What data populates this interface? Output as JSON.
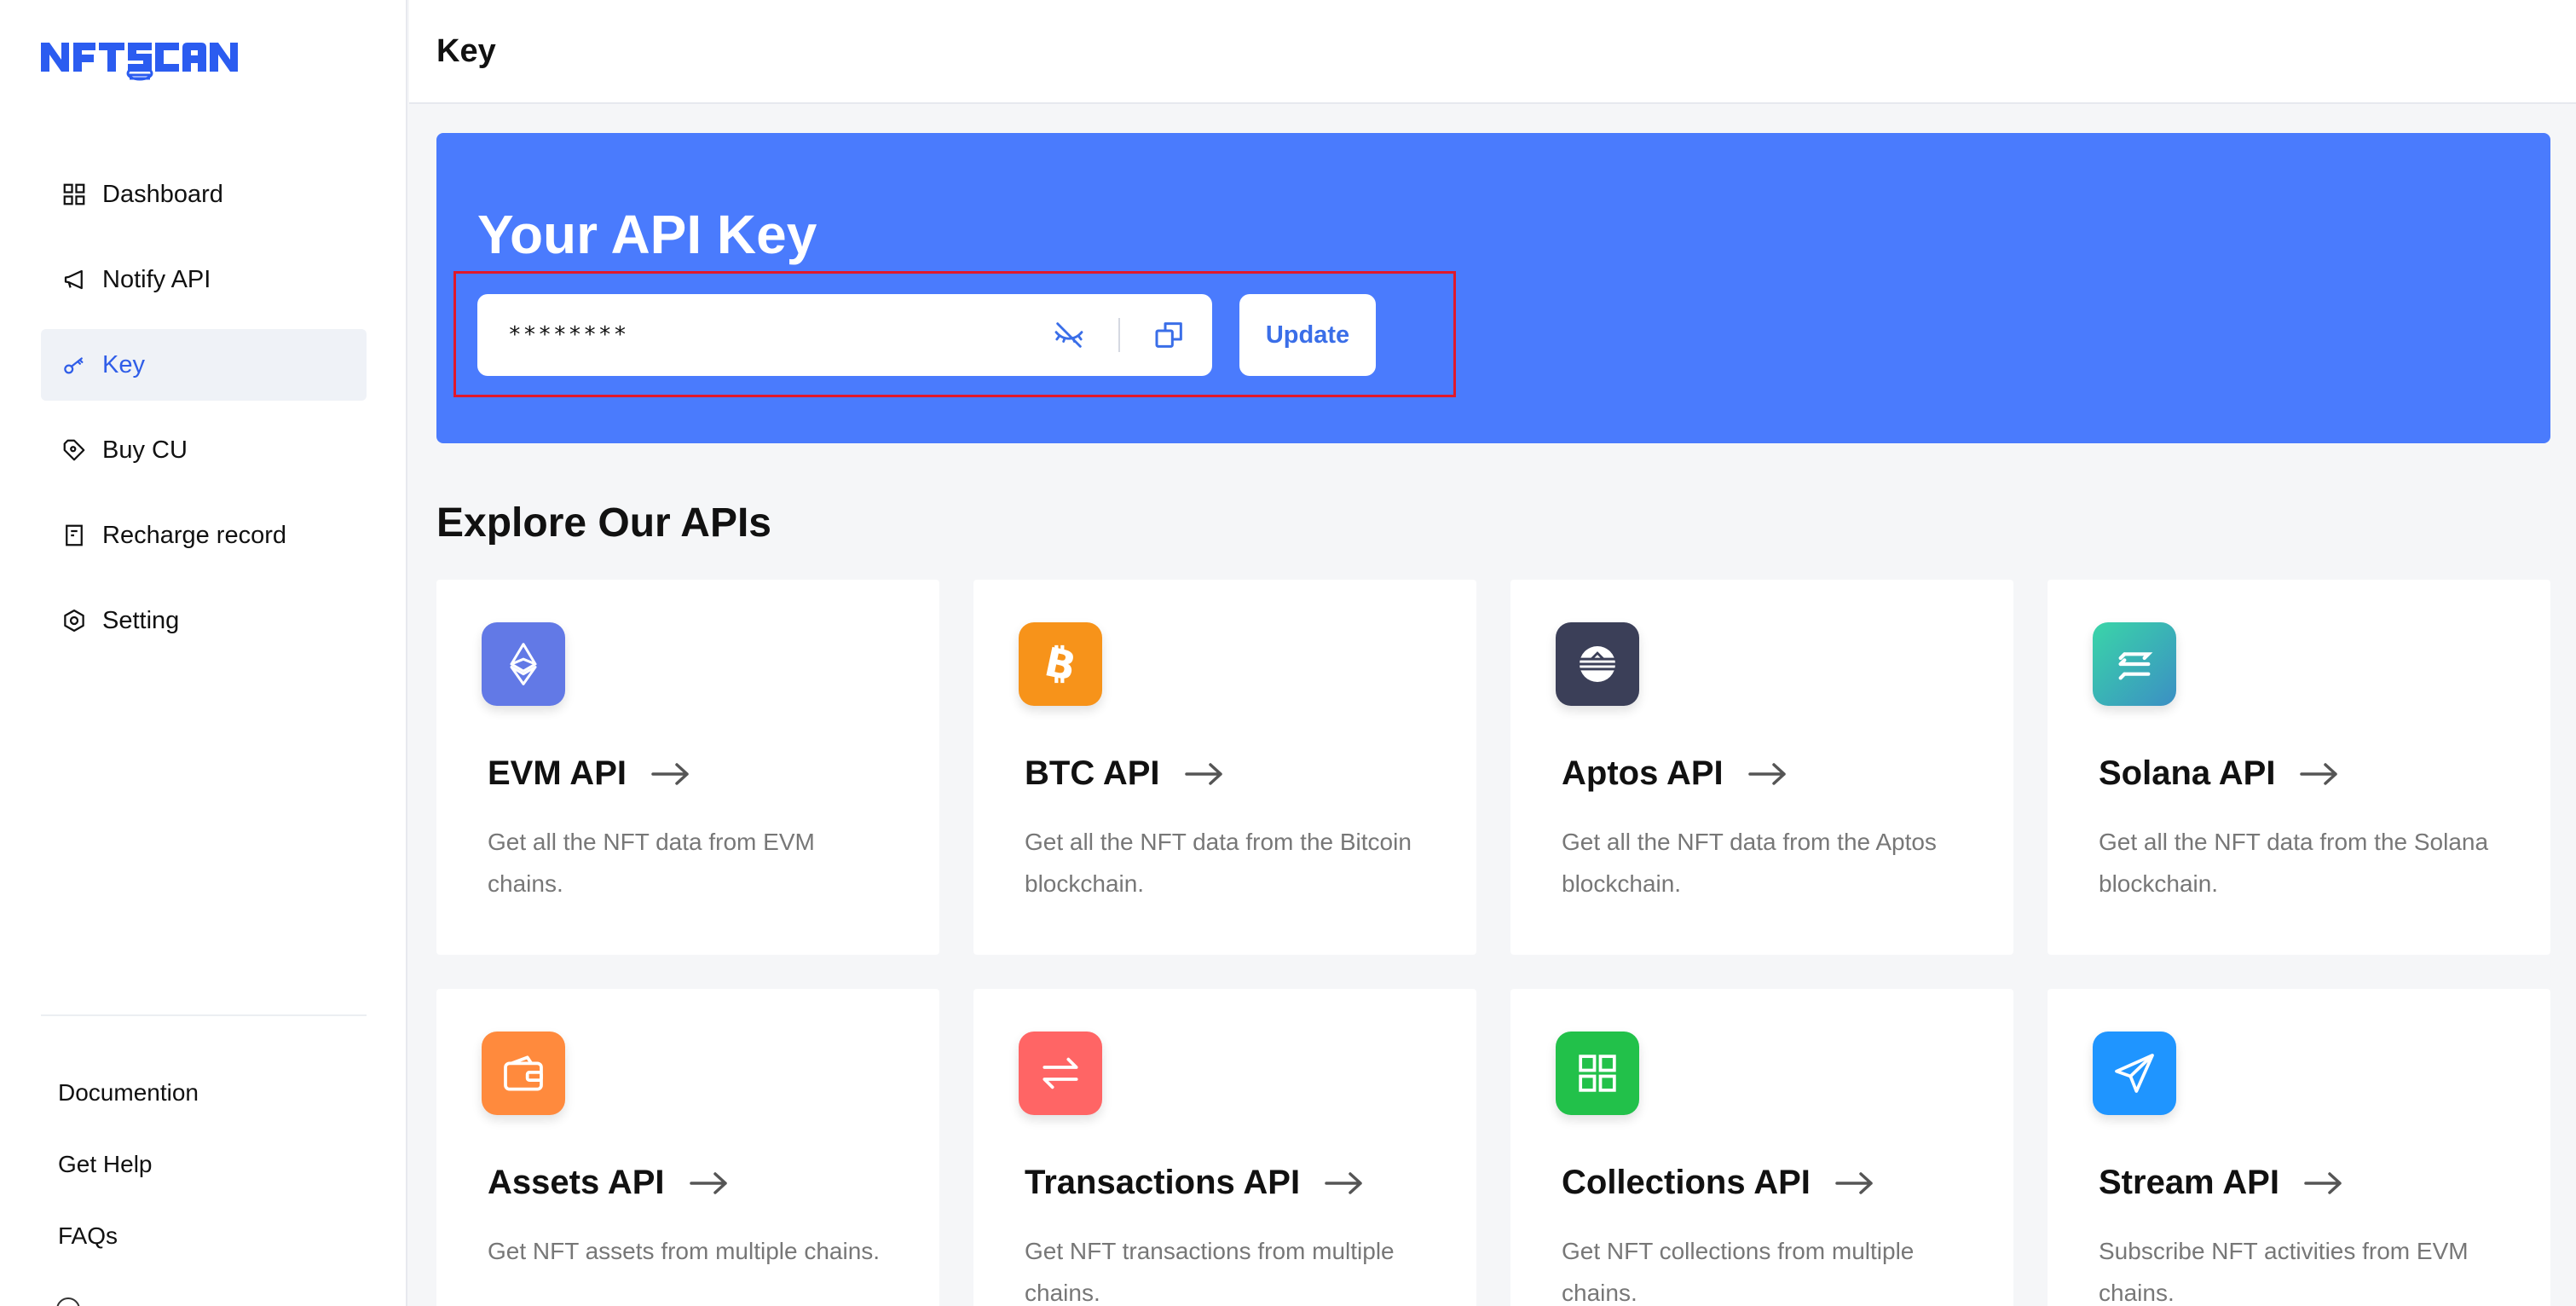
{
  "logo": {
    "text": "NFTSCAN",
    "color": "#2b5cf0"
  },
  "sidebar": {
    "items": [
      {
        "label": "Dashboard",
        "icon": "grid-icon",
        "active": false
      },
      {
        "label": "Notify API",
        "icon": "megaphone-icon",
        "active": false
      },
      {
        "label": "Key",
        "icon": "key-icon",
        "active": true
      },
      {
        "label": "Buy CU",
        "icon": "tag-icon",
        "active": false
      },
      {
        "label": "Recharge record",
        "icon": "document-icon",
        "active": false
      },
      {
        "label": "Setting",
        "icon": "hexagon-settings-icon",
        "active": false
      }
    ],
    "bottom_links": [
      "Documention",
      "Get Help",
      "FAQs"
    ]
  },
  "header": {
    "title": "Key"
  },
  "hero": {
    "title": "Your API Key",
    "key_value": "********",
    "update_label": "Update",
    "background": "#4a7bfd",
    "highlight_color": "#e0182a"
  },
  "explore": {
    "title": "Explore Our APIs",
    "cards": [
      {
        "title": "EVM API",
        "description": "Get all the NFT data from EVM chains.",
        "icon": "ethereum-icon",
        "color": "#6279e6"
      },
      {
        "title": "BTC API",
        "description": "Get all the NFT data from the Bitcoin blockchain.",
        "icon": "bitcoin-icon",
        "color": "#f7931a"
      },
      {
        "title": "Aptos API",
        "description": "Get all the NFT data from the Aptos blockchain.",
        "icon": "aptos-icon",
        "color": "#3b3f58"
      },
      {
        "title": "Solana API",
        "description": "Get all the NFT data from the Solana blockchain.",
        "icon": "solana-icon",
        "color": "#3cc6b0"
      },
      {
        "title": "Assets API",
        "description": "Get NFT assets from multiple chains.",
        "icon": "wallet-icon",
        "color": "#ff8a3d"
      },
      {
        "title": "Transactions API",
        "description": "Get NFT transactions from multiple chains.",
        "icon": "swap-icon",
        "color": "#ff6565"
      },
      {
        "title": "Collections API",
        "description": "Get NFT collections from multiple chains.",
        "icon": "grid-icon",
        "color": "#22c14a"
      },
      {
        "title": "Stream API",
        "description": "Subscribe NFT activities from EVM chains.",
        "icon": "paper-plane-icon",
        "color": "#1f95ff"
      }
    ]
  }
}
